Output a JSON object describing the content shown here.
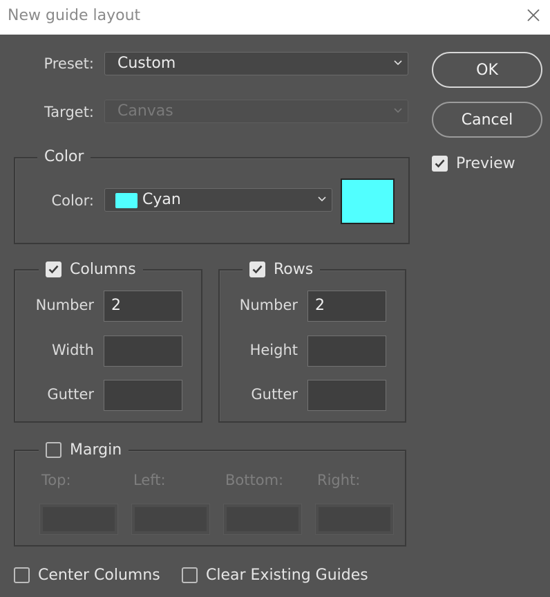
{
  "window": {
    "title": "New guide layout",
    "close_icon": "close-icon"
  },
  "preset": {
    "label": "Preset:",
    "value": "Custom"
  },
  "target": {
    "label": "Target:",
    "value": "Canvas",
    "disabled": true
  },
  "color_group": {
    "legend": "Color",
    "label": "Color:",
    "value": "Cyan",
    "swatch_color": "#51ffff"
  },
  "columns": {
    "legend": "Columns",
    "checked": true,
    "number_label": "Number",
    "number_value": "2",
    "width_label": "Width",
    "width_value": "",
    "gutter_label": "Gutter",
    "gutter_value": ""
  },
  "rows": {
    "legend": "Rows",
    "checked": true,
    "number_label": "Number",
    "number_value": "2",
    "height_label": "Height",
    "height_value": "",
    "gutter_label": "Gutter",
    "gutter_value": ""
  },
  "margin": {
    "legend": "Margin",
    "checked": false,
    "top_label": "Top:",
    "left_label": "Left:",
    "bottom_label": "Bottom:",
    "right_label": "Right:"
  },
  "buttons": {
    "ok": "OK",
    "cancel": "Cancel"
  },
  "preview": {
    "label": "Preview",
    "checked": true
  },
  "center_columns": {
    "label": "Center Columns",
    "checked": false
  },
  "clear_guides": {
    "label": "Clear Existing Guides",
    "checked": false
  },
  "colors": {
    "background": "#535353",
    "titlebar": "#ffffff",
    "accent_cyan": "#51ffff"
  }
}
